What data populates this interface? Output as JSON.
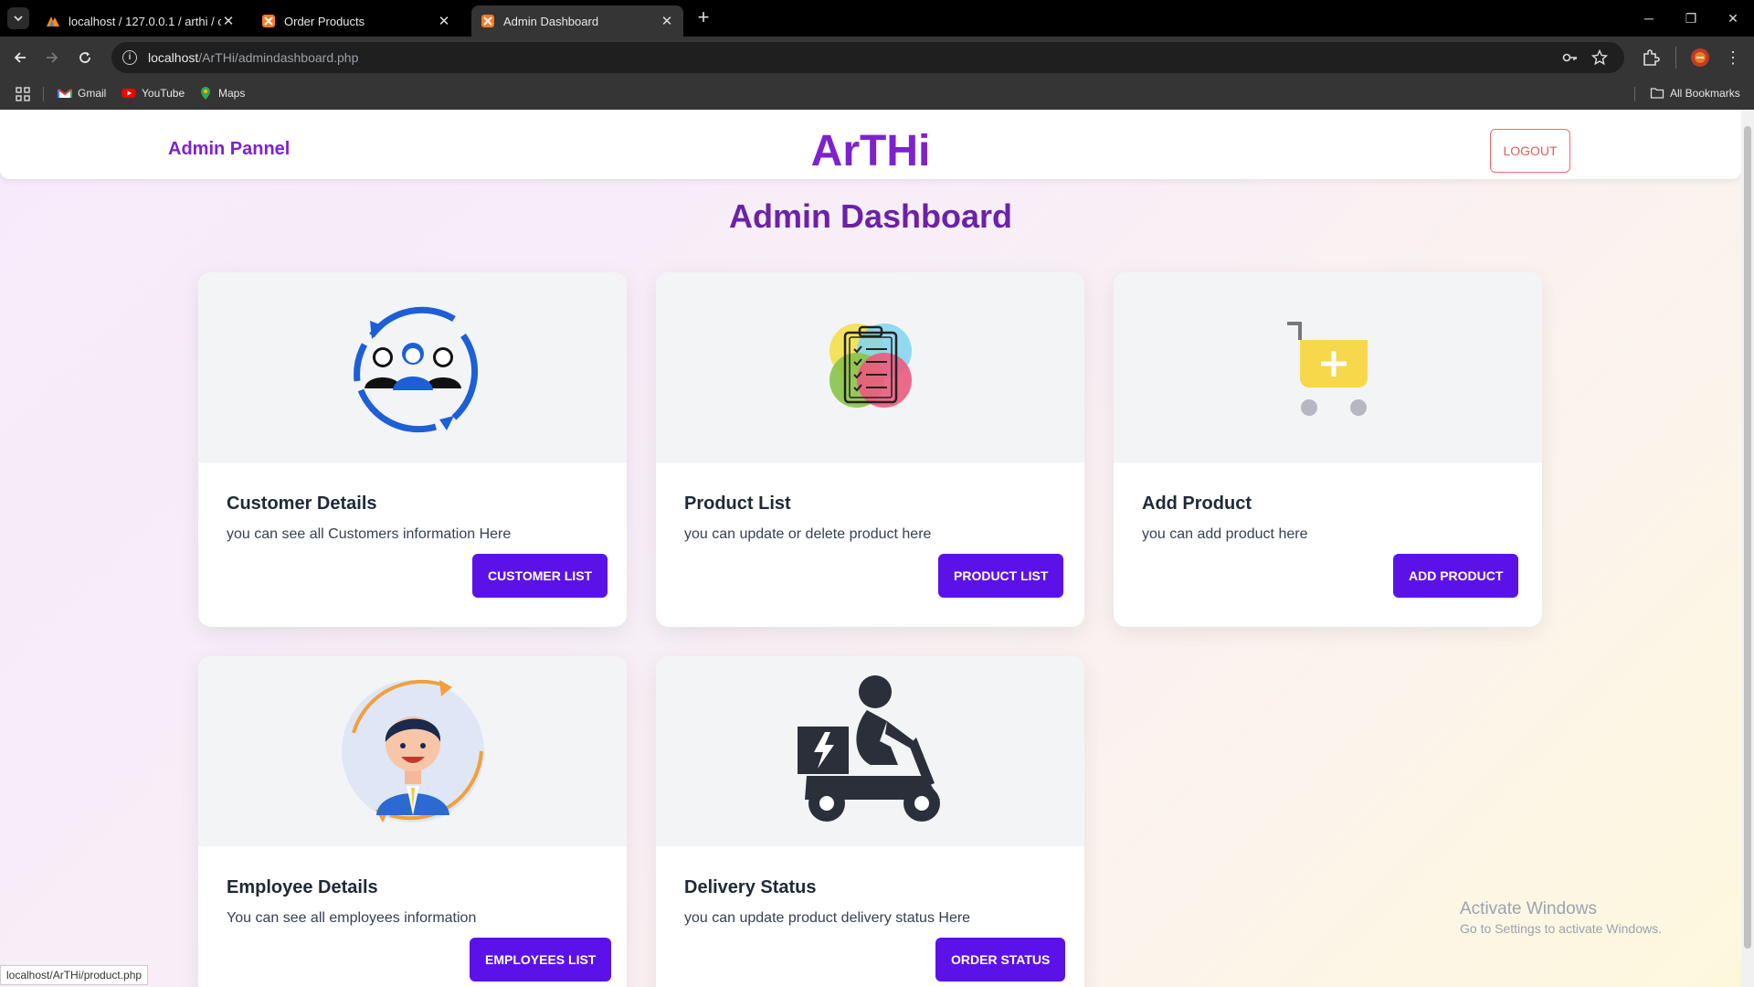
{
  "browser": {
    "tabs": [
      {
        "title": "localhost / 127.0.0.1 / arthi / cu",
        "icon": "phpmyadmin-icon"
      },
      {
        "title": "Order Products",
        "icon": "xampp-icon"
      },
      {
        "title": "Admin Dashboard",
        "icon": "xampp-icon",
        "active": true
      }
    ],
    "url_host": "localhost",
    "url_path": "/ArTHi/admindashboard.php",
    "bookmarks": [
      {
        "label": "Gmail",
        "icon": "gmail-icon"
      },
      {
        "label": "YouTube",
        "icon": "youtube-icon"
      },
      {
        "label": "Maps",
        "icon": "maps-icon"
      }
    ],
    "all_bookmarks": "All Bookmarks",
    "status_url": "localhost/ArTHi/product.php"
  },
  "header": {
    "left_label": "Admin Pannel",
    "brand": "ArTHi",
    "logout": "LOGOUT"
  },
  "dashboard": {
    "title": "Admin Dashboard",
    "cards": [
      {
        "title": "Customer Details",
        "desc": "you can see all Customers information Here",
        "button": "CUSTOMER LIST",
        "icon": "customers-cycle-icon"
      },
      {
        "title": "Product List",
        "desc": "you can update or delete product here",
        "button": "PRODUCT LIST",
        "icon": "clipboard-checklist-icon"
      },
      {
        "title": "Add Product",
        "desc": "you can add product here",
        "button": "ADD PRODUCT",
        "icon": "cart-add-icon"
      },
      {
        "title": "Employee Details",
        "desc": "You can see all employees information",
        "button": "EMPLOYEES LIST",
        "icon": "employee-avatar-icon"
      },
      {
        "title": "Delivery Status",
        "desc": "you can update product delivery status Here",
        "button": "ORDER STATUS",
        "icon": "delivery-scooter-icon"
      }
    ]
  },
  "watermark": {
    "line1": "Activate Windows",
    "line2": "Go to Settings to activate Windows."
  },
  "colors": {
    "brand_purple": "#7e22ce",
    "button_purple": "#5b12e8",
    "logout_red": "#e35d5d"
  }
}
